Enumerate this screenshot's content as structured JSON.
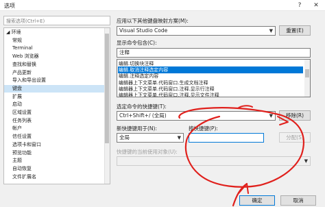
{
  "window": {
    "title": "选项",
    "help_glyph": "?",
    "close_glyph": "✕"
  },
  "search": {
    "placeholder": "搜索选项(Ctrl+E)"
  },
  "tree": {
    "items": [
      {
        "label": "◢ 环境",
        "indent": 0
      },
      {
        "label": "常规",
        "indent": 1
      },
      {
        "label": "Terminal",
        "indent": 1
      },
      {
        "label": "Web 浏览器",
        "indent": 1
      },
      {
        "label": "查找和替换",
        "indent": 1
      },
      {
        "label": "产品更新",
        "indent": 1
      },
      {
        "label": "导入和导出设置",
        "indent": 1
      },
      {
        "label": "键盘",
        "indent": 1,
        "selected": true
      },
      {
        "label": "扩展",
        "indent": 1
      },
      {
        "label": "启动",
        "indent": 1
      },
      {
        "label": "区域设置",
        "indent": 1
      },
      {
        "label": "任务列表",
        "indent": 1
      },
      {
        "label": "帐户",
        "indent": 1
      },
      {
        "label": "信任设置",
        "indent": 1
      },
      {
        "label": "选项卡和窗口",
        "indent": 1
      },
      {
        "label": "预览功能",
        "indent": 1
      },
      {
        "label": "主题",
        "indent": 1
      },
      {
        "label": "自动恢复",
        "indent": 1
      },
      {
        "label": "文件扩展名",
        "indent": 1
      }
    ]
  },
  "keyboard": {
    "mapping_label": "应用以下其他键盘映射方案(M):",
    "mapping_value": "Visual Studio Code",
    "reset_button": "重置(E)",
    "contains_label": "显示命令包含(C):",
    "contains_value": "注释",
    "commands": [
      {
        "label": "编辑.切换块注释"
      },
      {
        "label": "编辑.取消注释选定内容",
        "selected": true
      },
      {
        "label": "编辑.注释选定内容"
      },
      {
        "label": "编辑器上下文菜单.代码窗口.生成文档注释"
      },
      {
        "label": "编辑器上下文菜单.代码窗口.注释.显示行注释"
      },
      {
        "label": "编辑器上下文菜单.代码窗口.注释.显示文件注释"
      }
    ],
    "shortcut_label": "选定命令的快捷键(T):",
    "shortcut_value": "Ctrl+Shift+/ (全局)",
    "remove_button": "移除(R)",
    "use_in_label": "新快捷键用于(N):",
    "use_in_value": "全局",
    "press_label": "按快捷键(P):",
    "press_value": "",
    "assign_button": "分配(S)",
    "currently_used_label": "快捷键的当前使用对象(U):",
    "currently_used_value": ""
  },
  "footer": {
    "ok_button": "确定",
    "cancel_button": "取消"
  },
  "colors": {
    "selection": "#0078d7",
    "tree_selection": "#cce4f7",
    "annotation_red": "#e0201c"
  }
}
